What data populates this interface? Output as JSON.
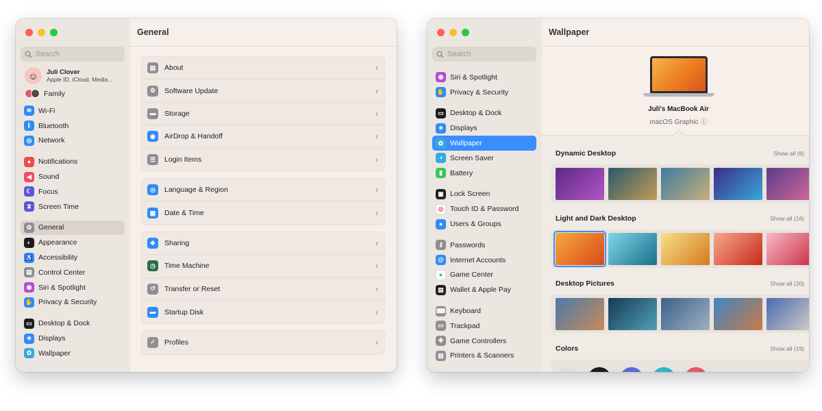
{
  "win1": {
    "title": "General",
    "search_placeholder": "Search",
    "user": {
      "name": "Juli Clover",
      "subtitle": "Apple ID, iCloud, Media..."
    },
    "family_label": "Family",
    "sidebar_groups": [
      [
        {
          "label": "Wi-Fi",
          "icon": "wifi-icon",
          "color": "#2f8bf7",
          "glyph": "≋"
        },
        {
          "label": "Bluetooth",
          "icon": "bluetooth-icon",
          "color": "#2f8bf7",
          "glyph": "ᛒ"
        },
        {
          "label": "Network",
          "icon": "globe-icon",
          "color": "#2f8bf7",
          "glyph": "◎"
        }
      ],
      [
        {
          "label": "Notifications",
          "icon": "bell-icon",
          "color": "#ee4b4b",
          "glyph": "●"
        },
        {
          "label": "Sound",
          "icon": "speaker-icon",
          "color": "#ee4b64",
          "glyph": "◀"
        },
        {
          "label": "Focus",
          "icon": "moon-icon",
          "color": "#5a58d6",
          "glyph": "☾"
        },
        {
          "label": "Screen Time",
          "icon": "hourglass-icon",
          "color": "#5a58d6",
          "glyph": "⧗"
        }
      ],
      [
        {
          "label": "General",
          "icon": "gear-icon",
          "color": "#8e8e93",
          "glyph": "⚙",
          "selected": true
        },
        {
          "label": "Appearance",
          "icon": "appearance-icon",
          "color": "#1d1d1f",
          "glyph": "◐"
        },
        {
          "label": "Accessibility",
          "icon": "accessibility-icon",
          "color": "#2f8bf7",
          "glyph": "♿"
        },
        {
          "label": "Control Center",
          "icon": "control-center-icon",
          "color": "#8e8e93",
          "glyph": "▤"
        },
        {
          "label": "Siri & Spotlight",
          "icon": "siri-icon",
          "color": "#b44bd6",
          "glyph": "◉"
        },
        {
          "label": "Privacy & Security",
          "icon": "hand-icon",
          "color": "#2f8bf7",
          "glyph": "✋"
        }
      ],
      [
        {
          "label": "Desktop & Dock",
          "icon": "dock-icon",
          "color": "#1d1d1f",
          "glyph": "▭"
        },
        {
          "label": "Displays",
          "icon": "sun-icon",
          "color": "#2f8bf7",
          "glyph": "☀"
        },
        {
          "label": "Wallpaper",
          "icon": "flower-icon",
          "color": "#35aadc",
          "glyph": "✿"
        }
      ]
    ],
    "settings_cards": [
      [
        {
          "label": "About",
          "icon": "info-icon",
          "color": "#8e8e93",
          "glyph": "▤"
        },
        {
          "label": "Software Update",
          "icon": "update-icon",
          "color": "#8e8e93",
          "glyph": "⚙"
        },
        {
          "label": "Storage",
          "icon": "storage-icon",
          "color": "#8e8e93",
          "glyph": "▬"
        },
        {
          "label": "AirDrop & Handoff",
          "icon": "airdrop-icon",
          "color": "#2f8bf7",
          "glyph": "◉"
        },
        {
          "label": "Login Items",
          "icon": "list-icon",
          "color": "#8e8e93",
          "glyph": "☰"
        }
      ],
      [
        {
          "label": "Language & Region",
          "icon": "globe-icon",
          "color": "#2f8bf7",
          "glyph": "◎"
        },
        {
          "label": "Date & Time",
          "icon": "calendar-icon",
          "color": "#2f8bf7",
          "glyph": "▦"
        }
      ],
      [
        {
          "label": "Sharing",
          "icon": "sharing-icon",
          "color": "#2f8bf7",
          "glyph": "◆"
        },
        {
          "label": "Time Machine",
          "icon": "time-machine-icon",
          "color": "#2e6b4f",
          "glyph": "◷"
        },
        {
          "label": "Transfer or Reset",
          "icon": "reset-icon",
          "color": "#8e8e93",
          "glyph": "↺"
        },
        {
          "label": "Startup Disk",
          "icon": "disk-icon",
          "color": "#2f8bf7",
          "glyph": "▬"
        }
      ],
      [
        {
          "label": "Profiles",
          "icon": "checkmark-icon",
          "color": "#8e8e93",
          "glyph": "✓"
        }
      ]
    ]
  },
  "win2": {
    "title": "Wallpaper",
    "search_placeholder": "Search",
    "sidebar_groups": [
      [
        {
          "label": "Siri & Spotlight",
          "icon": "siri-icon",
          "color": "#b44bd6",
          "glyph": "◉"
        },
        {
          "label": "Privacy & Security",
          "icon": "hand-icon",
          "color": "#2f8bf7",
          "glyph": "✋"
        }
      ],
      [
        {
          "label": "Desktop & Dock",
          "icon": "dock-icon",
          "color": "#1d1d1f",
          "glyph": "▭"
        },
        {
          "label": "Displays",
          "icon": "sun-icon",
          "color": "#2f8bf7",
          "glyph": "☀"
        },
        {
          "label": "Wallpaper",
          "icon": "flower-icon",
          "color": "#35aadc",
          "glyph": "✿",
          "selected": true
        },
        {
          "label": "Screen Saver",
          "icon": "screen-saver-icon",
          "color": "#35aadc",
          "glyph": "◑"
        },
        {
          "label": "Battery",
          "icon": "battery-icon",
          "color": "#34c759",
          "glyph": "▮"
        }
      ],
      [
        {
          "label": "Lock Screen",
          "icon": "lock-icon",
          "color": "#1d1d1f",
          "glyph": "▣"
        },
        {
          "label": "Touch ID & Password",
          "icon": "fingerprint-icon",
          "color": "#ffffff",
          "glyph": "◎",
          "fg": "#ee4b64"
        },
        {
          "label": "Users & Groups",
          "icon": "users-icon",
          "color": "#2f8bf7",
          "glyph": "●"
        }
      ],
      [
        {
          "label": "Passwords",
          "icon": "key-icon",
          "color": "#8e8e93",
          "glyph": "⚷"
        },
        {
          "label": "Internet Accounts",
          "icon": "at-icon",
          "color": "#2f8bf7",
          "glyph": "@"
        },
        {
          "label": "Game Center",
          "icon": "game-center-icon",
          "color": "#ffffff",
          "glyph": "●",
          "fg": "#34c759"
        },
        {
          "label": "Wallet & Apple Pay",
          "icon": "wallet-icon",
          "color": "#1d1d1f",
          "glyph": "▤"
        }
      ],
      [
        {
          "label": "Keyboard",
          "icon": "keyboard-icon",
          "color": "#8e8e93",
          "glyph": "⌨"
        },
        {
          "label": "Trackpad",
          "icon": "trackpad-icon",
          "color": "#8e8e93",
          "glyph": "▭"
        },
        {
          "label": "Game Controllers",
          "icon": "controller-icon",
          "color": "#8e8e93",
          "glyph": "✚"
        },
        {
          "label": "Printers & Scanners",
          "icon": "printer-icon",
          "color": "#8e8e93",
          "glyph": "▥"
        }
      ]
    ],
    "device": {
      "name": "Juli's MacBook Air",
      "subtitle": "macOS Graphic ⓘ"
    },
    "sections": [
      {
        "title": "Dynamic Desktop",
        "show_all": "Show all (8)",
        "thumbs": [
          {
            "c1": "#5b2a86",
            "c2": "#b454c4"
          },
          {
            "c1": "#2a5a6a",
            "c2": "#c49a58"
          },
          {
            "c1": "#3f7aa0",
            "c2": "#c8b07a"
          },
          {
            "c1": "#3a2d8a",
            "c2": "#3aa7d6"
          },
          {
            "c1": "#5a3d88",
            "c2": "#d66a9a"
          }
        ]
      },
      {
        "title": "Light and Dark Desktop",
        "show_all": "Show all (16)",
        "thumbs": [
          {
            "c1": "#f6a93b",
            "c2": "#d84a1c",
            "selected": true
          },
          {
            "c1": "#7fd6e8",
            "c2": "#1b6f8a"
          },
          {
            "c1": "#f7e08a",
            "c2": "#d47a1c"
          },
          {
            "c1": "#f7a78f",
            "c2": "#c82a18"
          },
          {
            "c1": "#f7b8c8",
            "c2": "#c92a40"
          }
        ]
      },
      {
        "title": "Desktop Pictures",
        "show_all": "Show all (20)",
        "thumbs": [
          {
            "c1": "#4c7aa8",
            "c2": "#c78a5a"
          },
          {
            "c1": "#173a52",
            "c2": "#4fa0b8"
          },
          {
            "c1": "#3b5f8a",
            "c2": "#a0b0c0"
          },
          {
            "c1": "#3f86c0",
            "c2": "#c87a4a"
          },
          {
            "c1": "#4a6ab0",
            "c2": "#d8d0c8"
          }
        ]
      },
      {
        "title": "Colors",
        "show_all": "Show all (19)",
        "thumbs": [
          {
            "c1": "#e2ddd8",
            "c2": "#e2ddd8"
          },
          {
            "c1": "#1d1d1f",
            "c2": "#1d1d1f"
          },
          {
            "c1": "#5a6ad6",
            "c2": "#5a6ad6"
          },
          {
            "c1": "#2fb3c9",
            "c2": "#2fb3c9"
          },
          {
            "c1": "#e25a6a",
            "c2": "#e25a6a"
          }
        ]
      }
    ]
  }
}
